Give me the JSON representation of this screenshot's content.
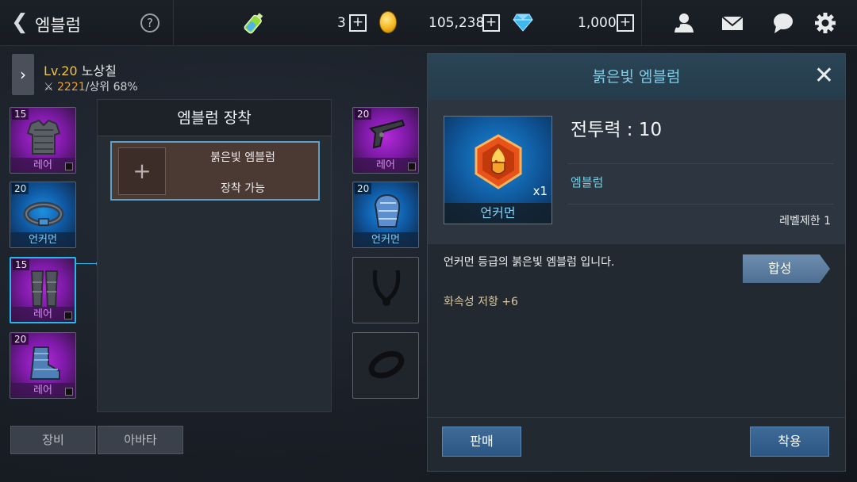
{
  "header": {
    "title": "엠블럼",
    "help": "?",
    "resource1_count": "3",
    "gold_count": "105,238",
    "diamond_count": "1,000",
    "plus": "+",
    "icons": [
      "back-icon",
      "help-icon",
      "potion-icon",
      "plus-icon",
      "gold-coin-icon",
      "diamond-icon",
      "friends-icon",
      "mail-icon",
      "chat-icon",
      "settings-icon"
    ]
  },
  "profile": {
    "level": "Lv.20",
    "name": "노상칠",
    "power": "2221",
    "rank": "/상위 68%"
  },
  "left_slots": [
    {
      "level": "15",
      "rank": "레어"
    },
    {
      "level": "20",
      "rank": "언커먼"
    },
    {
      "level": "15",
      "rank": "레어"
    },
    {
      "level": "20",
      "rank": "레어"
    }
  ],
  "right_slots": [
    {
      "level": "20",
      "rank": "레어"
    },
    {
      "level": "20",
      "rank": "언커먼"
    },
    {
      "level": "",
      "rank": ""
    },
    {
      "level": "",
      "rank": ""
    }
  ],
  "equip_panel": {
    "title": "엠블럼 장착",
    "plus": "+",
    "emblem_name": "붉은빛 엠블럼",
    "emblem_state": "장착 가능"
  },
  "tabs": [
    "장비",
    "아바타"
  ],
  "detail": {
    "title": "붉은빛 엠블럼",
    "close": "✕",
    "power": "전투력 : 10",
    "category": "엠블럼",
    "level_req": "레벨제한 1",
    "item_rank": "언커먼",
    "quantity": "x1",
    "description": "언커먼 등급의 붉은빛 엠블럼 입니다.",
    "stat": "화속성 저항 +6",
    "synth_button": "합성",
    "sell_button": "판매",
    "equip_button": "착용"
  },
  "colors": {
    "accent": "#28b7e8",
    "gold": "#f0c341",
    "rare": "#d58af0",
    "uncommon": "#7fd0f5"
  }
}
